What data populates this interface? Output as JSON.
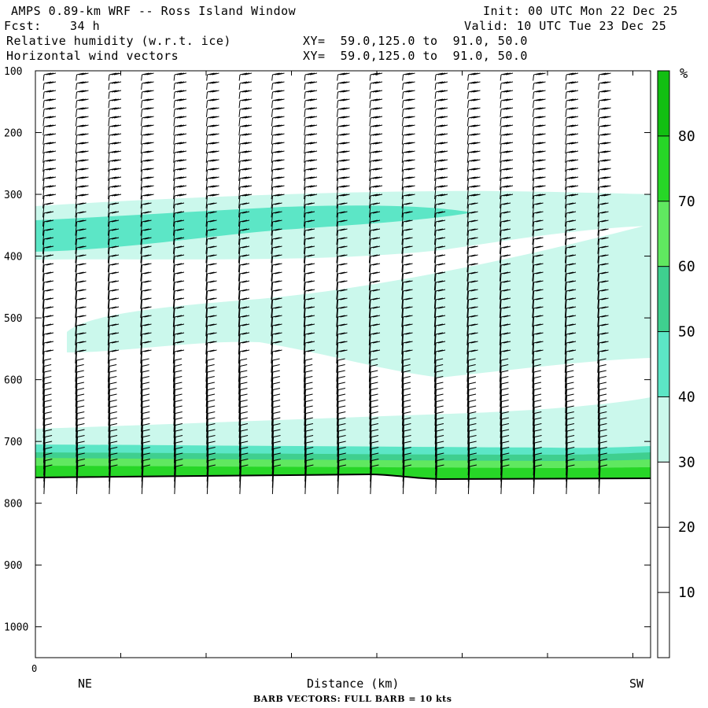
{
  "header": {
    "model": "AMPS 0.89-km WRF -- Ross Island Window",
    "init": "Init: 00 UTC Mon 22 Dec 25",
    "fcst_label": "Fcst:",
    "fcst_value": "34 h",
    "valid": "Valid: 10 UTC Tue 23 Dec 25",
    "field1": "Relative humidity (w.r.t. ice)",
    "field1_xy": "XY=  59.0,125.0 to  91.0, 50.0",
    "field2": "Horizontal wind vectors",
    "field2_xy": "XY=  59.0,125.0 to  91.0, 50.0"
  },
  "colorbar": {
    "unit": "%",
    "labels": [
      "80",
      "70",
      "60",
      "50",
      "40",
      "30",
      "20",
      "10"
    ],
    "levels": [
      0,
      10,
      20,
      30,
      40,
      50,
      60,
      70,
      80,
      90
    ],
    "colors": [
      "#ffffff",
      "#ffffff",
      "#ffffff",
      "#cbf8ec",
      "#5ce6c6",
      "#3fcf8f",
      "#60e860",
      "#27d627",
      "#12bf12"
    ]
  },
  "chart_data": {
    "type": "area",
    "title": "Relative humidity (w.r.t. ice)",
    "xlabel": "Distance (km)",
    "ylabel": "",
    "x_left_label": "NE",
    "x_right_label": "SW",
    "x_origin_label": "0",
    "yticks": [
      100,
      200,
      300,
      400,
      500,
      600,
      700,
      800,
      900,
      1000
    ],
    "ylim": [
      1050,
      100
    ],
    "terrain_pressure_hpa": 760,
    "rh_regions": [
      {
        "category": "30-40",
        "description": "upper moist layer",
        "pressure_top_hpa": 300,
        "pressure_bottom_hpa": 400
      },
      {
        "category": "40-50",
        "description": "upper moist core (NE side)",
        "pressure_top_hpa": 325,
        "pressure_bottom_hpa": 375
      },
      {
        "category": "30-40",
        "description": "mid layer",
        "pressure_top_hpa": 450,
        "pressure_bottom_hpa": 560
      },
      {
        "category": "30-40",
        "description": "SW mid layer",
        "pressure_top_hpa": 360,
        "pressure_bottom_hpa": 700
      },
      {
        "category": "40-80",
        "description": "boundary layer above terrain",
        "pressure_top_hpa": 700,
        "pressure_bottom_hpa": 760
      }
    ],
    "wind_barb_columns": 18,
    "barb_key": "BARB VECTORS:  FULL BARB = 10 kts"
  }
}
